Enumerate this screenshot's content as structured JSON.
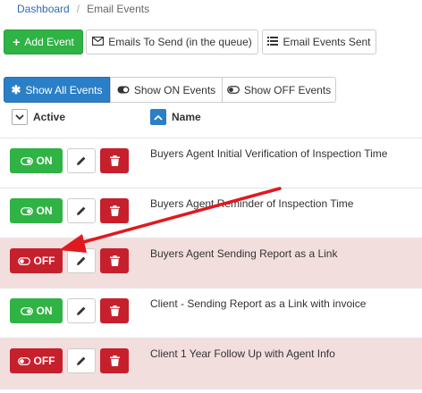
{
  "breadcrumb": {
    "home": "Dashboard",
    "separator": "/",
    "current": "Email Events"
  },
  "toolbar": {
    "add_event": "Add Event",
    "emails_to_send": "Emails To Send (in the queue)",
    "email_events_sent": "Email Events Sent"
  },
  "filters": {
    "show_all": "Show All Events",
    "show_on": "Show ON Events",
    "show_off": "Show OFF Events"
  },
  "table": {
    "col_active": "Active",
    "col_name": "Name",
    "rows": [
      {
        "status": "ON",
        "name": "Buyers Agent Initial Verification of Inspection Time"
      },
      {
        "status": "ON",
        "name": "Buyers Agent Reminder of Inspection Time"
      },
      {
        "status": "OFF",
        "name": "Buyers Agent Sending Report as a Link"
      },
      {
        "status": "ON",
        "name": "Client - Sending Report as a Link with invoice"
      },
      {
        "status": "OFF",
        "name": "Client 1 Year Follow Up with Agent Info"
      }
    ]
  },
  "colors": {
    "green": "#2fb344",
    "red": "#c7202d",
    "blue": "#2a7fc7",
    "off_row_bg": "#f3dede",
    "annotation_arrow": "#e0191f"
  }
}
